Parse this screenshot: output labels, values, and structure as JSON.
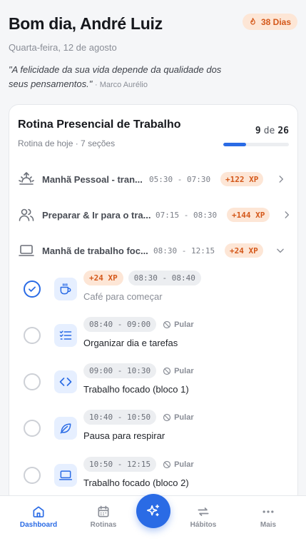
{
  "header": {
    "greeting": "Bom dia, André Luiz",
    "date": "Quarta-feira, 12 de agosto",
    "quote_text": "\"A felicidade da sua vida depende da qualidade dos seus pensamentos.\"",
    "quote_author": "· Marco Aurélio",
    "streak_label": "38 Dias"
  },
  "routine": {
    "title": "Rotina Presencial de Trabalho",
    "subtitle": "Rotina de hoje · 7 seções",
    "done": "9",
    "of": "de",
    "total": "26",
    "progress_fraction": 0.35,
    "sections": [
      {
        "name": "Manhã Pessoal - tran...",
        "time": "05:30 - 07:30",
        "xp": "+122 XP",
        "icon": "sunrise-icon"
      },
      {
        "name": "Preparar & Ir para o tra...",
        "time": "07:15 - 08:30",
        "xp": "+144 XP",
        "icon": "users-icon"
      },
      {
        "name": "Manhã de trabalho foc...",
        "time": "08:30 - 12:15",
        "xp": "+24 XP",
        "icon": "laptop-icon"
      }
    ],
    "tasks": [
      {
        "xp": "+24 XP",
        "time": "08:30 - 08:40",
        "name": "Café para começar",
        "done": true,
        "icon": "coffee-icon"
      },
      {
        "time": "08:40 - 09:00",
        "skip": "Pular",
        "name": "Organizar dia e tarefas",
        "done": false,
        "icon": "checklist-icon"
      },
      {
        "time": "09:00 - 10:30",
        "skip": "Pular",
        "name": "Trabalho focado (bloco 1)",
        "done": false,
        "icon": "code-icon"
      },
      {
        "time": "10:40 - 10:50",
        "skip": "Pular",
        "name": "Pausa para respirar",
        "done": false,
        "icon": "leaf-icon"
      },
      {
        "time": "10:50 - 12:15",
        "skip": "Pular",
        "name": "Trabalho focado (bloco 2)",
        "done": false,
        "icon": "laptop-icon"
      }
    ]
  },
  "nav": {
    "dashboard": "Dashboard",
    "rotinas": "Rotinas",
    "habitos": "Hábitos",
    "mais": "Mais"
  },
  "colors": {
    "accent": "#2a6be5",
    "xp_bg": "#fde6d6",
    "xp_text": "#d4581a"
  }
}
